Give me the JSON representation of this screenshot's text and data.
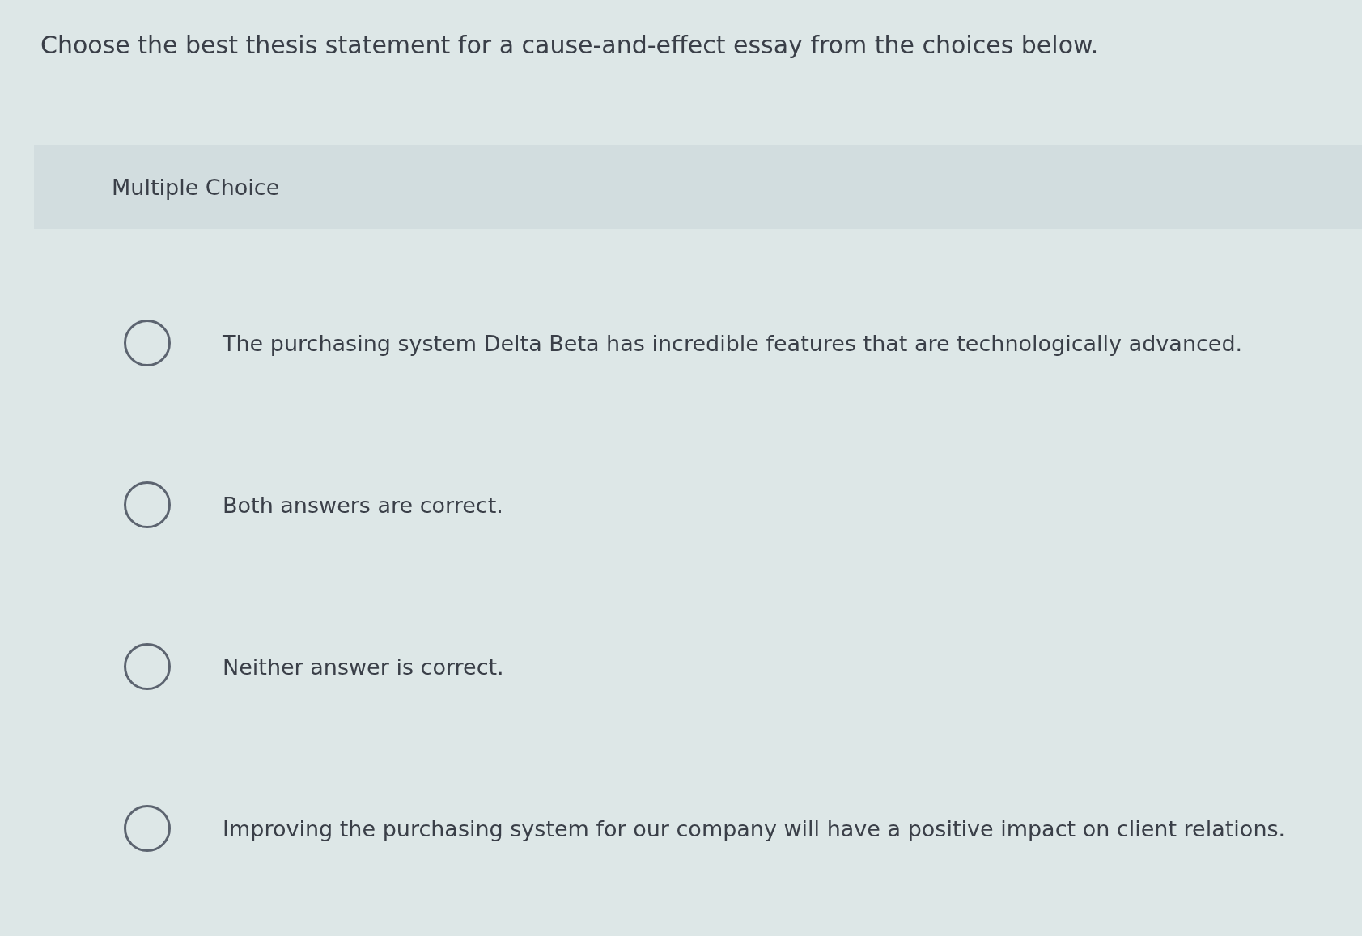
{
  "question": {
    "prompt": "Choose the best thesis statement for a cause-and-effect essay from the choices below."
  },
  "header": {
    "label": "Multiple Choice"
  },
  "options": [
    {
      "text": "The purchasing system Delta Beta has incredible features that are technologically advanced.",
      "selected": false
    },
    {
      "text": "Both answers are correct.",
      "selected": false
    },
    {
      "text": "Neither answer is correct.",
      "selected": false
    },
    {
      "text": "Improving the purchasing system for our company will have a positive impact on client relations.",
      "selected": false
    }
  ]
}
